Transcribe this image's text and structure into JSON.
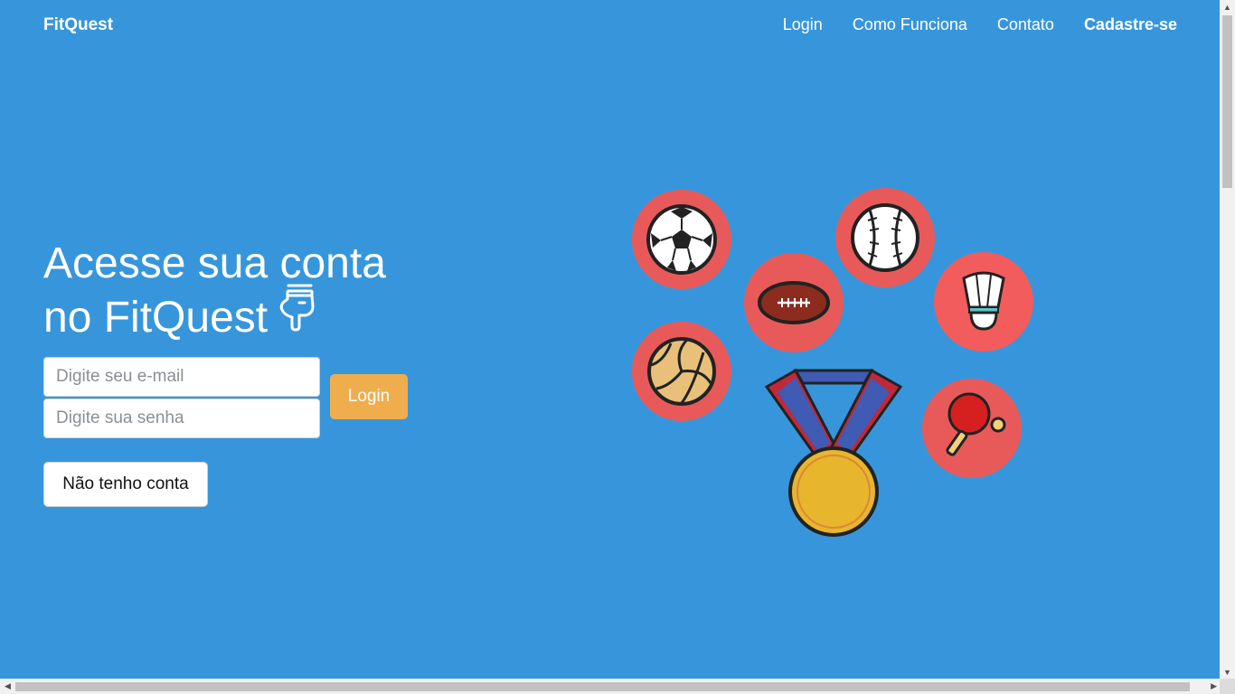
{
  "brand": "FitQuest",
  "nav": {
    "login": "Login",
    "como_funciona": "Como Funciona",
    "contato": "Contato",
    "cadastre": "Cadastre-se"
  },
  "hero": {
    "title_line1": "Acesse sua conta",
    "title_line2": "no FitQuest"
  },
  "form": {
    "email_placeholder": "Digite seu e-mail",
    "senha_placeholder": "Digite sua senha",
    "login_button": "Login",
    "no_account_button": "Não tenho conta"
  },
  "colors": {
    "background": "#3796db",
    "accent": "#f0ad4e",
    "circle": "#e85a5a"
  },
  "icons": [
    "hand-pointing-icon",
    "soccer-ball-icon",
    "baseball-icon",
    "football-icon",
    "shuttlecock-icon",
    "volleyball-icon",
    "ping-pong-paddle-icon",
    "medal-icon"
  ]
}
